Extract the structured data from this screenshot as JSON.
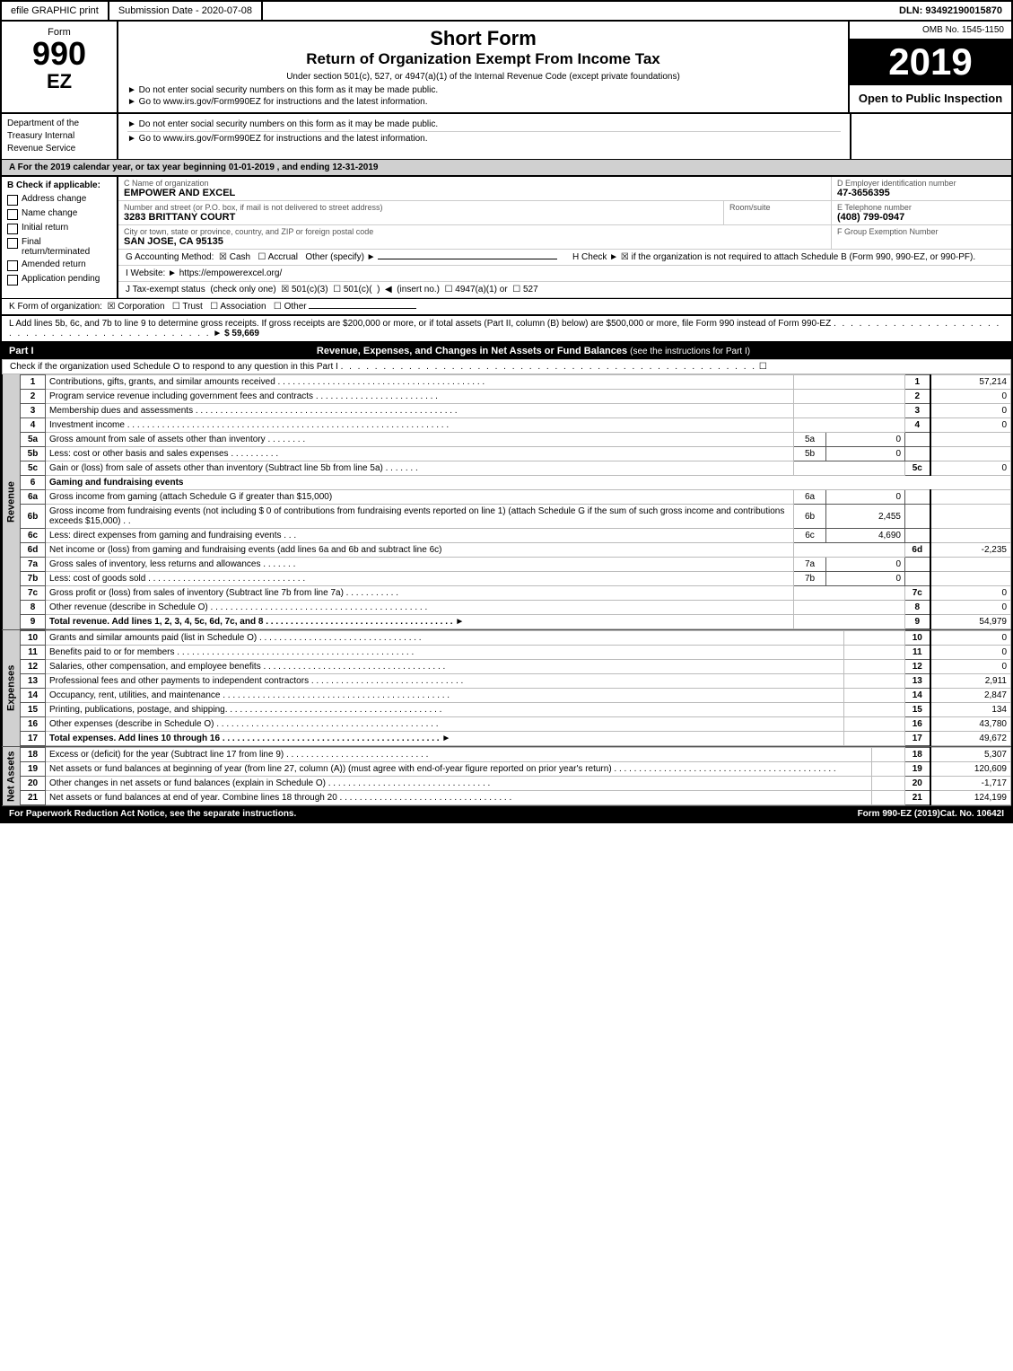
{
  "topbar": {
    "graphic_print": "efile GRAPHIC print",
    "submission_label": "Submission Date - 2020-07-08",
    "dln_label": "DLN: 93492190015870"
  },
  "form_header": {
    "form_label": "Form",
    "form_number": "990EZ",
    "title_main": "Short Form",
    "title_sub": "Return of Organization Exempt From Income Tax",
    "subtitle": "Under section 501(c), 527, or 4947(a)(1) of the Internal Revenue Code (except private foundations)",
    "note1": "► Do not enter social security numbers on this form as it may be made public.",
    "note2": "► Go to www.irs.gov/Form990EZ for instructions and the latest information.",
    "omb": "OMB No. 1545-1150",
    "year": "2019",
    "open_to_public": "Open to Public Inspection"
  },
  "dept": {
    "name": "Department of the Treasury Internal Revenue Service"
  },
  "section_a": {
    "label": "A  For the 2019 calendar year, or tax year beginning 01-01-2019 , and ending 12-31-2019"
  },
  "checkboxes": {
    "b_label": "B  Check if applicable:",
    "items": [
      {
        "label": "Address change",
        "checked": false
      },
      {
        "label": "Name change",
        "checked": false
      },
      {
        "label": "Initial return",
        "checked": false
      },
      {
        "label": "Final return/terminated",
        "checked": false
      },
      {
        "label": "Amended return",
        "checked": false
      },
      {
        "label": "Application pending",
        "checked": false
      }
    ]
  },
  "org_info": {
    "c_label": "C Name of organization",
    "org_name": "EMPOWER AND EXCEL",
    "address_label": "Number and street (or P.O. box, if mail is not delivered to street address)",
    "address": "3283 BRITTANY COURT",
    "room_label": "Room/suite",
    "room": "",
    "city_label": "City or town, state or province, country, and ZIP or foreign postal code",
    "city": "SAN JOSE, CA  95135",
    "d_label": "D Employer identification number",
    "ein": "47-3656395",
    "e_label": "E Telephone number",
    "phone": "(408) 799-0947",
    "f_label": "F Group Exemption Number",
    "group_num": ""
  },
  "accounting": {
    "g_label": "G Accounting Method:",
    "cash": "Cash",
    "accrual": "Accrual",
    "other": "Other (specify) ►",
    "cash_checked": true,
    "accrual_checked": false,
    "h_label": "H  Check ►",
    "h_note": "if the organization is not required to attach Schedule B (Form 990, 990-EZ, or 990-PF).",
    "h_checked": true
  },
  "website": {
    "i_label": "I Website: ►",
    "url": "https://empowerexcel.org/"
  },
  "tax_status": {
    "j_label": "J Tax-exempt status",
    "j_note": "(check only one)",
    "options": [
      {
        "label": "501(c)(3)",
        "checked": true
      },
      {
        "label": "501(c)(",
        "checked": false
      },
      {
        "label": ") ◄ (insert no.)",
        "checked": false
      },
      {
        "label": "4947(a)(1) or",
        "checked": false
      },
      {
        "label": "527",
        "checked": false
      }
    ]
  },
  "k_row": {
    "label": "K Form of organization:",
    "corporation": "Corporation",
    "trust": "Trust",
    "association": "Association",
    "other": "Other",
    "corporation_checked": true,
    "trust_checked": false,
    "association_checked": false,
    "other_checked": false
  },
  "l_row": {
    "text": "L Add lines 5b, 6c, and 7b to line 9 to determine gross receipts. If gross receipts are $200,000 or more, or if total assets (Part II, column (B) below) are $500,000 or more, file Form 990 instead of Form 990-EZ",
    "dots": ". . . . . . . . . . . . . . . . . . . . . . . . . . . . . . . . . . . . . . . . . . . .",
    "arrow": "►",
    "amount": "$ 59,669"
  },
  "part1": {
    "label": "Part I",
    "title": "Revenue, Expenses, and Changes in Net Assets or Fund Balances",
    "note": "(see the instructions for Part I)",
    "check_note": "Check if the organization used Schedule O to respond to any question in this Part I",
    "check_dots": ". . . . . . . . . . . . . . . . . . . . . . . . . . . . . . . . . . . . . . . . . . . . . . . . .",
    "lines": [
      {
        "num": "1",
        "desc": "Contributions, gifts, grants, and similar amounts received",
        "dots": ". . . . . . . . . . . . . . . . . . . . . . . . . . . . . . . . . . . . . . . . . .",
        "lineref": "1",
        "amount": "57,214"
      },
      {
        "num": "2",
        "desc": "Program service revenue including government fees and contracts",
        "dots": ". . . . . . . . . . . . . . . . . . . . . . . . .",
        "lineref": "2",
        "amount": "0"
      },
      {
        "num": "3",
        "desc": "Membership dues and assessments",
        "dots": ". . . . . . . . . . . . . . . . . . . . . . . . . . . . . . . . . . . . . . . . . . . . . . . . . . . . .",
        "lineref": "3",
        "amount": "0"
      },
      {
        "num": "4",
        "desc": "Investment income",
        "dots": ". . . . . . . . . . . . . . . . . . . . . . . . . . . . . . . . . . . . . . . . . . . . . . . . . . . . . . . . . . . . . . . . .",
        "lineref": "4",
        "amount": "0"
      },
      {
        "num": "5a",
        "desc": "Gross amount from sale of assets other than inventory",
        "dots": ". . . . . . . .",
        "lineref": "5a",
        "inner_amount": "0",
        "amount": ""
      },
      {
        "num": "5b",
        "desc": "Less: cost or other basis and sales expenses",
        "dots": ". . . . . . . . . .",
        "lineref": "5b",
        "inner_amount": "0",
        "amount": ""
      },
      {
        "num": "5c",
        "desc": "Gain or (loss) from sale of assets other than inventory (Subtract line 5b from line 5a)",
        "dots": ". . . . . . .",
        "lineref": "5c",
        "amount": "0"
      },
      {
        "num": "6",
        "desc": "Gaming and fundraising events",
        "dots": "",
        "lineref": "",
        "amount": ""
      },
      {
        "num": "6a",
        "desc": "Gross income from gaming (attach Schedule G if greater than $15,000)",
        "dots": "",
        "lineref": "6a",
        "inner_amount": "0",
        "amount": ""
      },
      {
        "num": "6b",
        "desc": "Gross income from fundraising events (not including $ 0 of contributions from fundraising events reported on line 1) (attach Schedule G if the sum of such gross income and contributions exceeds $15,000)",
        "dots": ". .",
        "lineref": "6b",
        "inner_amount": "2,455",
        "amount": ""
      },
      {
        "num": "6c",
        "desc": "Less: direct expenses from gaming and fundraising events",
        "dots": ". . .",
        "lineref": "6c",
        "inner_amount": "4,690",
        "amount": ""
      },
      {
        "num": "6d",
        "desc": "Net income or (loss) from gaming and fundraising events (add lines 6a and 6b and subtract line 6c)",
        "dots": "",
        "lineref": "6d",
        "amount": "-2,235"
      },
      {
        "num": "7a",
        "desc": "Gross sales of inventory, less returns and allowances",
        "dots": ". . . . . . .",
        "lineref": "7a",
        "inner_amount": "0",
        "amount": ""
      },
      {
        "num": "7b",
        "desc": "Less: cost of goods sold",
        "dots": ". . . . . . . . . . . . . . . . . . . . . . . . . . . . . . . .",
        "lineref": "7b",
        "inner_amount": "0",
        "amount": ""
      },
      {
        "num": "7c",
        "desc": "Gross profit or (loss) from sales of inventory (Subtract line 7b from line 7a)",
        "dots": ". . . . . . . . . . .",
        "lineref": "7c",
        "amount": "0"
      },
      {
        "num": "8",
        "desc": "Other revenue (describe in Schedule O)",
        "dots": ". . . . . . . . . . . . . . . . . . . . . . . . . . . . . . . . . . . . . . . . . . . .",
        "lineref": "8",
        "amount": "0"
      },
      {
        "num": "9",
        "desc": "Total revenue. Add lines 1, 2, 3, 4, 5c, 6d, 7c, and 8",
        "dots": ". . . . . . . . . . . . . . . . . . . . . . . . . . . . . . . . . . . . . .",
        "arrow": "►",
        "lineref": "9",
        "amount": "54,979",
        "bold": true
      }
    ]
  },
  "expenses": {
    "lines": [
      {
        "num": "10",
        "desc": "Grants and similar amounts paid (list in Schedule O)",
        "dots": ". . . . . . . . . . . . . . . . . . . . . . . . . . . . . . . . .",
        "lineref": "10",
        "amount": "0"
      },
      {
        "num": "11",
        "desc": "Benefits paid to or for members",
        "dots": ". . . . . . . . . . . . . . . . . . . . . . . . . . . . . . . . . . . . . . . . . . . . . . . .",
        "lineref": "11",
        "amount": "0"
      },
      {
        "num": "12",
        "desc": "Salaries, other compensation, and employee benefits",
        "dots": ". . . . . . . . . . . . . . . . . . . . . . . . . . . . . . . . . . . . .",
        "lineref": "12",
        "amount": "0"
      },
      {
        "num": "13",
        "desc": "Professional fees and other payments to independent contractors",
        "dots": ". . . . . . . . . . . . . . . . . . . . . . . . . . . . . . .",
        "lineref": "13",
        "amount": "2,911"
      },
      {
        "num": "14",
        "desc": "Occupancy, rent, utilities, and maintenance",
        "dots": ". . . . . . . . . . . . . . . . . . . . . . . . . . . . . . . . . . . . . . . . . . . . . .",
        "lineref": "14",
        "amount": "2,847"
      },
      {
        "num": "15",
        "desc": "Printing, publications, postage, and shipping.",
        "dots": ". . . . . . . . . . . . . . . . . . . . . . . . . . . . . . . . . . . . . . . . . . .",
        "lineref": "15",
        "amount": "134"
      },
      {
        "num": "16",
        "desc": "Other expenses (describe in Schedule O)",
        "dots": ". . . . . . . . . . . . . . . . . . . . . . . . . . . . . . . . . . . . . . . . . . . . .",
        "lineref": "16",
        "amount": "43,780"
      },
      {
        "num": "17",
        "desc": "Total expenses. Add lines 10 through 16",
        "dots": ". . . . . . . . . . . . . . . . . . . . . . . . . . . . . . . . . . . . . . . . . . . .",
        "arrow": "►",
        "lineref": "17",
        "amount": "49,672",
        "bold": true
      }
    ]
  },
  "net_assets": {
    "lines": [
      {
        "num": "18",
        "desc": "Excess or (deficit) for the year (Subtract line 17 from line 9)",
        "dots": ". . . . . . . . . . . . . . . . . . . . . . . . . . . . .",
        "lineref": "18",
        "amount": "5,307"
      },
      {
        "num": "19",
        "desc": "Net assets or fund balances at beginning of year (from line 27, column (A)) (must agree with end-of-year figure reported on prior year's return)",
        "dots": ". . . . . . . . . . . . . . . . . . . . . . . . . . . . . . . . . . . . . . . . . . . . .",
        "lineref": "19",
        "amount": "120,609"
      },
      {
        "num": "20",
        "desc": "Other changes in net assets or fund balances (explain in Schedule O)",
        "dots": ". . . . . . . . . . . . . . . . . . . . . . . . . . . . . . . . .",
        "lineref": "20",
        "amount": "-1,717"
      },
      {
        "num": "21",
        "desc": "Net assets or fund balances at end of year. Combine lines 18 through 20",
        "dots": ". . . . . . . . . . . . . . . . . . . . . . . . . . . . . . . . . . .",
        "lineref": "21",
        "amount": "124,199"
      }
    ]
  },
  "footer": {
    "paperwork": "For Paperwork Reduction Act Notice, see the separate instructions.",
    "cat_no": "Cat. No. 10642I",
    "form_ref": "Form 990-EZ (2019)"
  }
}
